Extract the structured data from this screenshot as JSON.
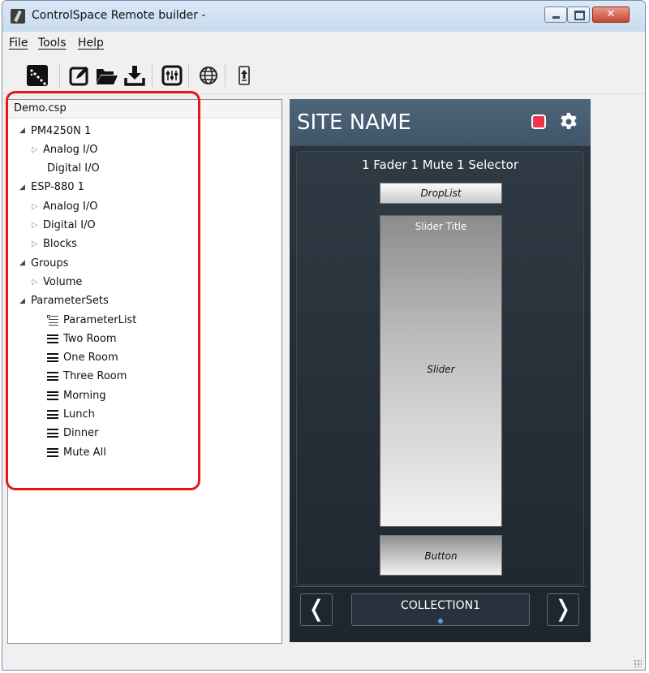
{
  "window": {
    "title": "ControlSpace Remote builder -",
    "controls": [
      "minimize-icon",
      "maximize-icon",
      "close-icon"
    ]
  },
  "menu": [
    "File",
    "Tools",
    "Help"
  ],
  "toolbar": {
    "icons": [
      "remote-launcher-icon",
      "edit-icon",
      "open-folder-icon",
      "download-icon",
      "settings-panel-icon",
      "globe-icon",
      "upload-device-icon"
    ]
  },
  "tree": {
    "header": "Demo.csp",
    "nodes": [
      {
        "label": "PM4250N 1",
        "arrow": "expanded",
        "icon": "none"
      },
      {
        "label": "Analog I/O",
        "arrow": "collapsed",
        "icon": "none"
      },
      {
        "label": "Digital I/O",
        "arrow": "none",
        "icon": "none"
      },
      {
        "label": "ESP-880 1",
        "arrow": "expanded",
        "icon": "none"
      },
      {
        "label": "Analog I/O",
        "arrow": "collapsed",
        "icon": "none"
      },
      {
        "label": "Digital I/O",
        "arrow": "collapsed",
        "icon": "none"
      },
      {
        "label": "Blocks",
        "arrow": "collapsed",
        "icon": "none"
      },
      {
        "label": "Groups",
        "arrow": "expanded",
        "icon": "none"
      },
      {
        "label": "Volume",
        "arrow": "collapsed",
        "icon": "none"
      },
      {
        "label": "ParameterSets",
        "arrow": "expanded",
        "icon": "none"
      },
      {
        "label": "ParameterList",
        "arrow": "none",
        "icon": "parameter-list-icon"
      },
      {
        "label": "Two Room",
        "arrow": "none",
        "icon": "parameter-set-icon"
      },
      {
        "label": "One Room",
        "arrow": "none",
        "icon": "parameter-set-icon"
      },
      {
        "label": "Three Room",
        "arrow": "none",
        "icon": "parameter-set-icon"
      },
      {
        "label": "Morning",
        "arrow": "none",
        "icon": "parameter-set-icon"
      },
      {
        "label": "Lunch",
        "arrow": "none",
        "icon": "parameter-set-icon"
      },
      {
        "label": "Dinner",
        "arrow": "none",
        "icon": "parameter-set-icon"
      },
      {
        "label": "Mute All",
        "arrow": "none",
        "icon": "parameter-set-icon"
      }
    ]
  },
  "preview": {
    "site_name": "SITE NAME",
    "panel_title": "1 Fader 1 Mute 1 Selector",
    "droplist": "DropList",
    "slider_title": "Slider Title",
    "slider_label": "Slider",
    "button_label": "Button",
    "collection": "COLLECTION1",
    "prev_symbol": "❬",
    "next_symbol": "❭",
    "accent_color": "#4aa3e8",
    "record_color": "#f0334e"
  },
  "annotation": {
    "highlight_color": "#e8151b"
  }
}
